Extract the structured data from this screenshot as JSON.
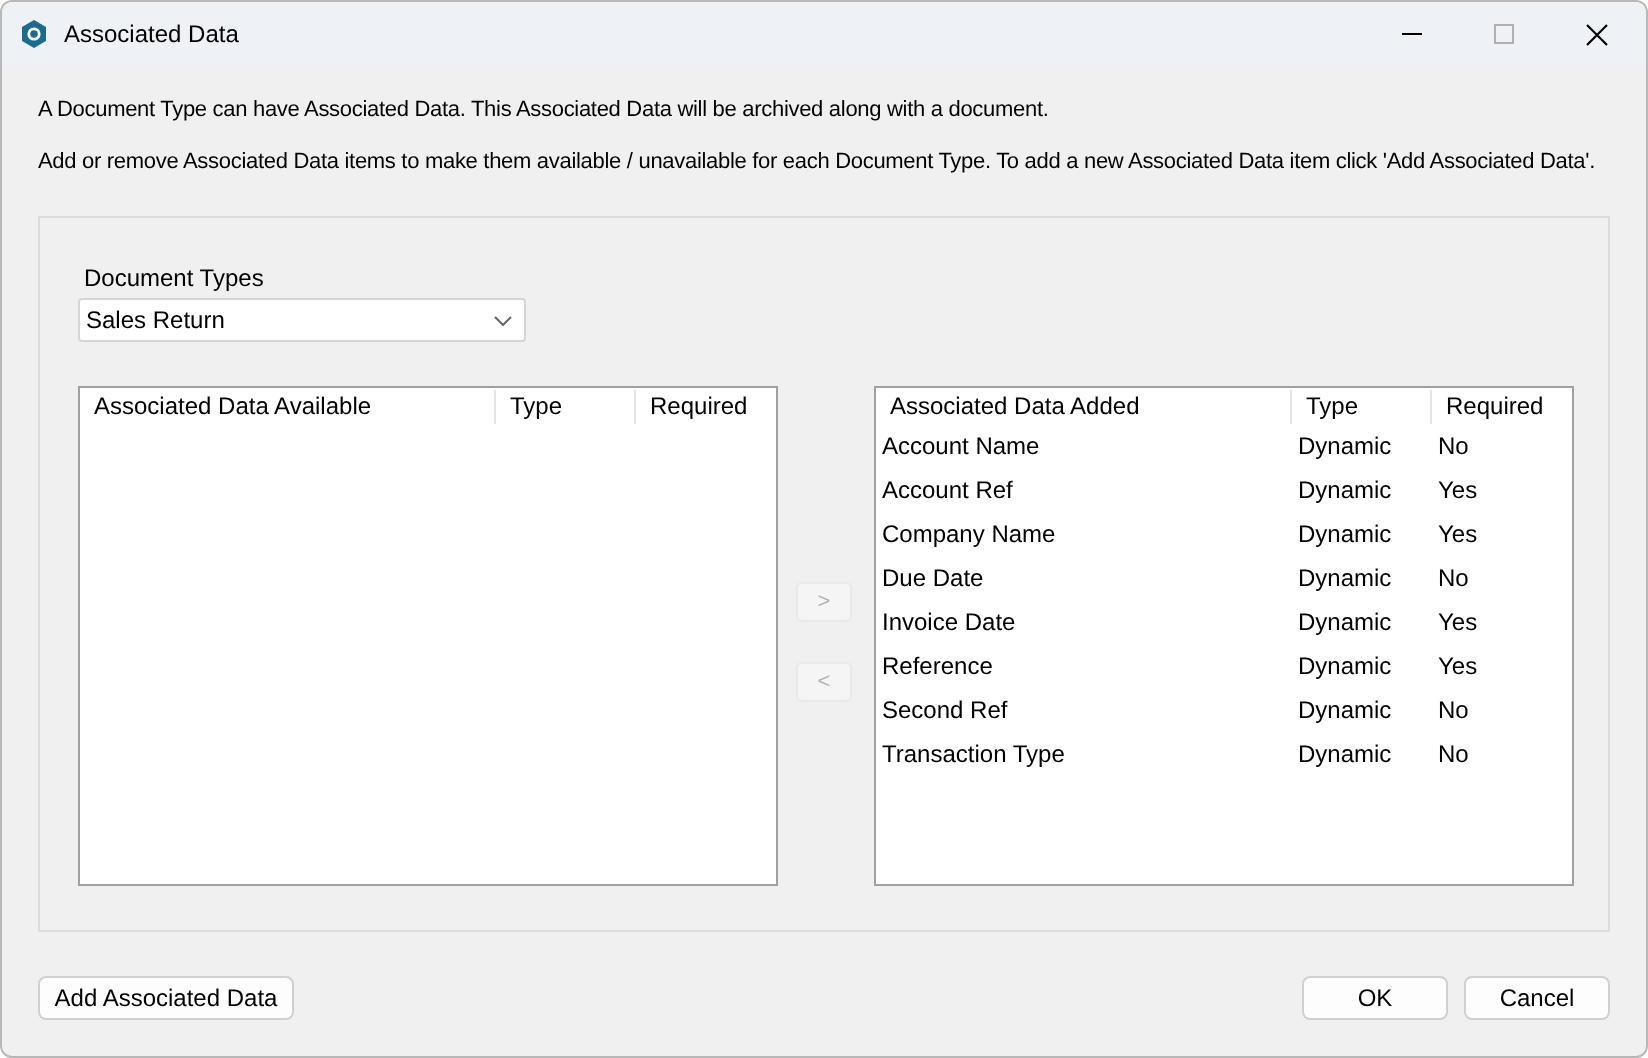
{
  "window": {
    "title": "Associated Data"
  },
  "intro": [
    "A Document Type can have Associated Data. This Associated Data will be archived along with a document.",
    "Add or remove Associated Data items to make them available / unavailable for each Document Type. To add a new Associated Data item click 'Add Associated Data'."
  ],
  "document_types": {
    "label": "Document Types",
    "value": "Sales Return"
  },
  "available": {
    "columns": [
      "Associated Data Available",
      "Type",
      "Required"
    ]
  },
  "move_buttons": [
    {
      "label": ">",
      "disabled": true
    },
    {
      "label": "<",
      "disabled": true
    }
  ],
  "added": {
    "columns": [
      "Associated Data Added",
      "Type",
      "Required"
    ],
    "rows": [
      [
        "Account Name",
        "Dynamic",
        "No"
      ],
      [
        "Account Ref",
        "Dynamic",
        "Yes"
      ],
      [
        "Company Name",
        "Dynamic",
        "Yes"
      ],
      [
        "Due Date",
        "Dynamic",
        "No"
      ],
      [
        "Invoice Date",
        "Dynamic",
        "Yes"
      ],
      [
        "Reference",
        "Dynamic",
        "Yes"
      ],
      [
        "Second Ref",
        "Dynamic",
        "No"
      ],
      [
        "Transaction Type",
        "Dynamic",
        "No"
      ]
    ]
  },
  "buttons": {
    "add": "Add Associated Data",
    "ok": "OK",
    "cancel": "Cancel"
  }
}
